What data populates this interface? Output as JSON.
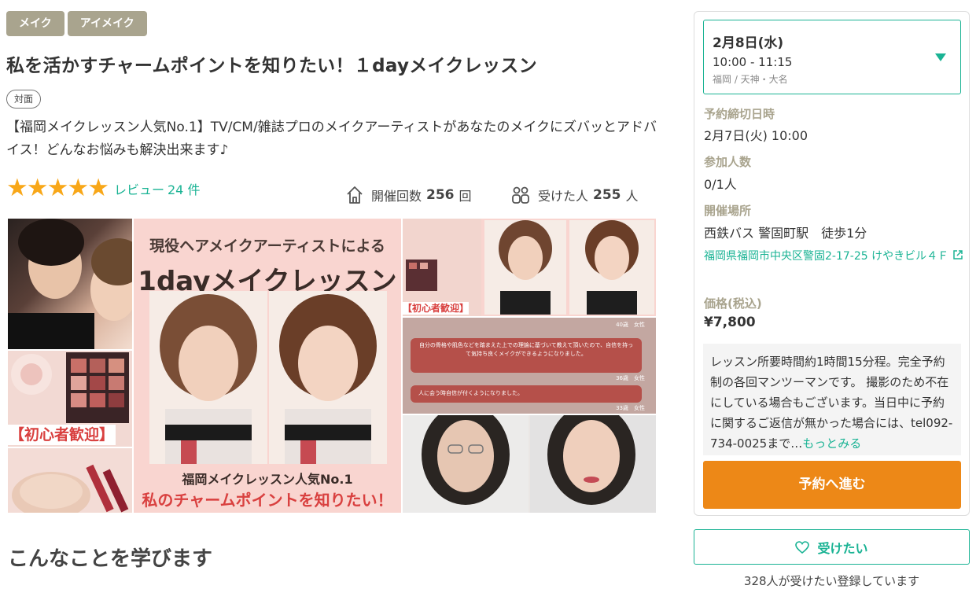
{
  "tags": [
    "メイク",
    "アイメイク"
  ],
  "title": "私を活かすチャームポイントを知りたい！１dayメイクレッスン",
  "format": "対面",
  "description": "【福岡メイクレッスン人気No.1】TV/CM/雑誌プロのメイクアーティストがあなたのメイクにズバッとアドバイス！どんなお悩みも解決出来ます♪",
  "rating": {
    "stars": 5,
    "review_label": "レビュー",
    "review_count": "24 件"
  },
  "stats": {
    "held_label": "開催回数",
    "held_value": "256",
    "held_unit": "回",
    "taken_label": "受けた人",
    "taken_value": "255",
    "taken_unit": "人"
  },
  "gallery": {
    "main_heading_1": "現役ヘアメイクアーティストによる",
    "main_heading_2": "1dayメイクレッスン",
    "main_sub_1": "福岡メイクレッスン人気No.1",
    "main_sub_2": "私のチャームポイントを知りたい！",
    "beginner_badge": "【初心者歓迎】",
    "beginner_badge_small": "【初心者歓迎】",
    "review_1": "自分の骨格や肌色などを踏まえた上での理論に基づいて教えて頂いたので、自信を持って気持ち良くメイクができるようになりました。",
    "review_1_meta": "36歳　女性",
    "review_2": "人に会う時自信が付くようになりました。",
    "review_2_meta": "33歳　女性",
    "review_0_meta": "40歳　女性"
  },
  "learn_title": "こんなことを学びます",
  "sidebar": {
    "date": "2月8日(水)",
    "time": "10:00 - 11:15",
    "area": "福岡 / 天神・大名",
    "deadline_label": "予約締切日時",
    "deadline_value": "2月7日(火) 10:00",
    "participants_label": "参加人数",
    "participants_value": "0/1人",
    "venue_label": "開催場所",
    "venue_value": "西鉄バス 警固町駅　徒歩1分",
    "address": "福岡県福岡市中央区警固2-17-25 けやきビル４Ｆ",
    "price_label": "価格(税込)",
    "price_value": "¥7,800",
    "notes": "レッスン所要時間約1時間15分程。完全予約制の各回マンツーマンです。 撮影のため不在にしている場合もございます。当日中に予約に関するご返信が無かった場合には、tel092-734-0025まで…",
    "notes_more": "もっとみる",
    "reserve_label": "予約へ進む"
  },
  "want": {
    "label": "受けたい",
    "count_text": "328人が受けたい登録しています"
  },
  "colors": {
    "accent": "#1ab394",
    "tag_bg": "#a9a48e",
    "cta": "#ed8817",
    "star": "#f8a718"
  }
}
